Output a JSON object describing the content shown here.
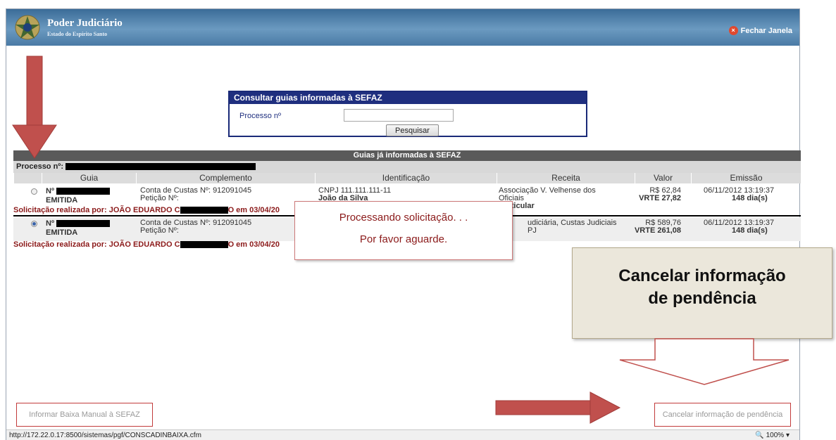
{
  "header": {
    "title": "Poder Judiciário",
    "subtitle": "Estado do Espírito Santo",
    "close_label": "Fechar Janela"
  },
  "search": {
    "title": "Consultar guias informadas à SEFAZ",
    "label": "Processo nº",
    "value": "",
    "button": "Pesquisar"
  },
  "results": {
    "title": "Guias já informadas à SEFAZ",
    "processo_label": "Processo nº:",
    "columns": [
      "Guia",
      "Complemento",
      "Identificação",
      "Receita",
      "Valor",
      "Emissão"
    ],
    "rows": [
      {
        "selected": false,
        "guia_prefix": "Nº",
        "status": "EMITIDA",
        "complemento_1": "Conta de Custas Nº: 912091045",
        "complemento_2": "Petição Nº:",
        "id_1": "CNPJ 111.111.111-11",
        "id_2": "João da Silva",
        "receita_1": "Associação V. Velhense dos",
        "receita_2": "Oficiais",
        "receita_3": "Particular",
        "valor": "R$ 62,84",
        "vrte": "VRTE 27,82",
        "emissao": "06/11/2012 13:19:37",
        "dias": "148 dia(s)",
        "req_prefix": "Solicitação realizada por: JOÃO EDUARDO C",
        "req_suffix": "O em 03/04/20"
      },
      {
        "selected": true,
        "guia_prefix": "Nº",
        "status": "EMITIDA",
        "complemento_1": "Conta de Custas Nº: 912091045",
        "complemento_2": "Petição Nº:",
        "receita_1": "udiciária, Custas Judiciais",
        "receita_2": "PJ",
        "valor": "R$ 589,76",
        "vrte": "VRTE 261,08",
        "emissao": "06/11/2012 13:19:37",
        "dias": "148 dia(s)",
        "req_prefix": "Solicitação realizada por: JOÃO EDUARDO C",
        "req_suffix": "O em 03/04/20"
      }
    ]
  },
  "processing": {
    "line1": "Processando solicitação. . .",
    "line2": "Por favor aguarde."
  },
  "buttons": {
    "manual": "Informar Baixa Manual à SEFAZ",
    "cancel": "Cancelar informação de pendência"
  },
  "status_bar": {
    "url": "http://172.22.0.17:8500/sistemas/pgf/CONSCADINBAIXA.cfm",
    "zoom": "100%"
  },
  "callout": {
    "line1": "Cancelar informação",
    "line2": "de pendência"
  },
  "colors": {
    "header": "#4a7aa5",
    "accent_red": "#c0504d",
    "text_red": "#8b1a1a",
    "search_border": "#1f2f7f"
  }
}
